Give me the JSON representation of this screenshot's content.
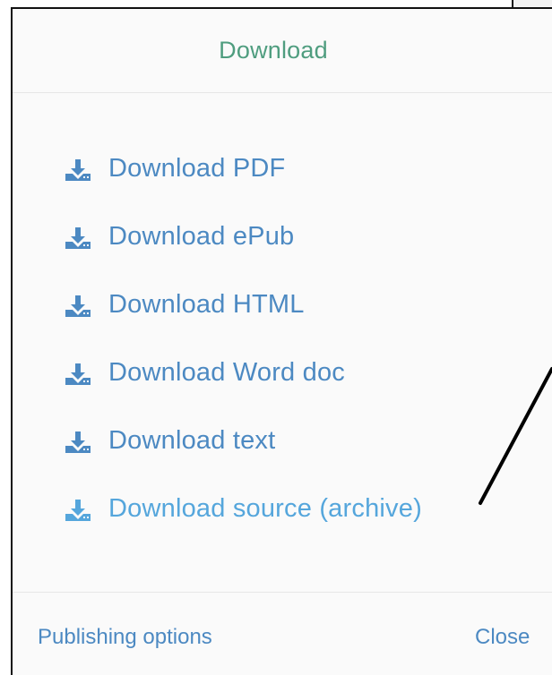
{
  "modal": {
    "title": "Download",
    "items": [
      {
        "label": "Download PDF",
        "icon": "download-icon",
        "color": "#4c89c2"
      },
      {
        "label": "Download ePub",
        "icon": "download-icon",
        "color": "#4c89c2"
      },
      {
        "label": "Download HTML",
        "icon": "download-icon",
        "color": "#4c89c2"
      },
      {
        "label": "Download Word doc",
        "icon": "download-icon",
        "color": "#4c89c2"
      },
      {
        "label": "Download text",
        "icon": "download-icon",
        "color": "#4c89c2"
      },
      {
        "label": "Download source (archive)",
        "icon": "download-icon",
        "color": "#55a6dc"
      }
    ],
    "footer": {
      "publishing_label": "Publishing options",
      "close_label": "Close"
    },
    "colors": {
      "title": "#4f9d7f",
      "link": "#4c89c2",
      "hover_link": "#55a6dc",
      "background": "#fafafa",
      "annotation": "#000000"
    }
  }
}
